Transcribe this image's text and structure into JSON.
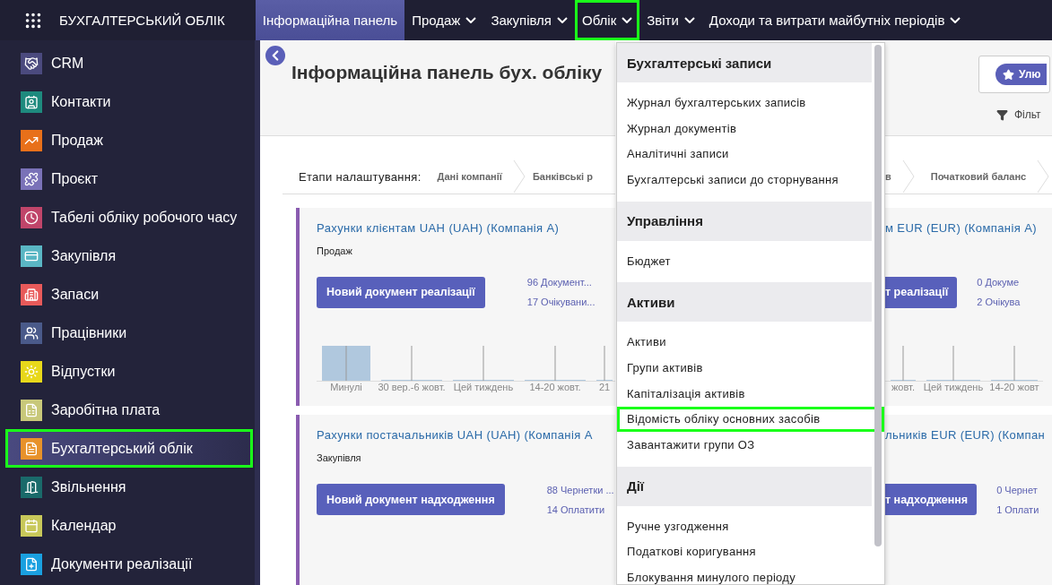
{
  "topbar": {
    "app_title": "БУХГАЛТЕРСЬКИЙ ОБЛІК",
    "menus": [
      {
        "label": "Інформаційна панель",
        "has_caret": false,
        "selected": true,
        "highlighted": false
      },
      {
        "label": "Продаж",
        "has_caret": true,
        "selected": false,
        "highlighted": false
      },
      {
        "label": "Закупівля",
        "has_caret": true,
        "selected": false,
        "highlighted": false
      },
      {
        "label": "Облік",
        "has_caret": true,
        "selected": false,
        "highlighted": true
      },
      {
        "label": "Звіти",
        "has_caret": true,
        "selected": false,
        "highlighted": false
      },
      {
        "label": "Доходи та витрати майбутніх періодів",
        "has_caret": true,
        "selected": false,
        "highlighted": false
      }
    ]
  },
  "sidebar": {
    "items": [
      {
        "label": "CRM",
        "color": "#4b4a7e",
        "selected": false,
        "highlighted": false
      },
      {
        "label": "Контакти",
        "color": "#1e8a7e",
        "selected": false,
        "highlighted": false
      },
      {
        "label": "Продаж",
        "color": "#e8701a",
        "selected": false,
        "highlighted": false
      },
      {
        "label": "Проєкт",
        "color": "#7a72b8",
        "selected": false,
        "highlighted": false
      },
      {
        "label": "Табелі обліку робочого часу",
        "color": "#c0456a",
        "selected": false,
        "highlighted": false
      },
      {
        "label": "Закупівля",
        "color": "#5ab6c4",
        "selected": false,
        "highlighted": false
      },
      {
        "label": "Запаси",
        "color": "#e85a5a",
        "selected": false,
        "highlighted": false
      },
      {
        "label": "Працівники",
        "color": "#4a5a8a",
        "selected": false,
        "highlighted": false
      },
      {
        "label": "Відпустки",
        "color": "#e8d81a",
        "selected": false,
        "highlighted": false
      },
      {
        "label": "Заробітна плата",
        "color": "#c8c87a",
        "selected": false,
        "highlighted": false
      },
      {
        "label": "Бухгалтерський облік",
        "color": "#e8922a",
        "selected": true,
        "highlighted": true
      },
      {
        "label": "Звільнення",
        "color": "#1a6a6a",
        "selected": false,
        "highlighted": false
      },
      {
        "label": "Календар",
        "color": "#c8c85a",
        "selected": false,
        "highlighted": false
      },
      {
        "label": "Документи реалізації",
        "color": "#1aa0e0",
        "selected": false,
        "highlighted": false
      }
    ]
  },
  "page": {
    "title": "Інформаційна панель бух. обліку",
    "favorites_button": "Улю",
    "filter_label": "Фільт",
    "setup": {
      "label": "Етапи налаштування:",
      "steps_left": [
        "Дані компанії",
        "Банківські р"
      ],
      "steps_right": [
        "в",
        "Початковий баланс"
      ]
    },
    "cards_left": [
      {
        "title": "Рахунки клієнтам UAH (UAH) (Компанія А)",
        "subtitle": "Продаж",
        "button": "Новий документ реалізації",
        "links": [
          "96 Документ...",
          "17 Очікувани..."
        ],
        "chart_labels": [
          "Минулі",
          "30 вер.-6 жовт.",
          "Цей тиждень",
          "14-20 жовт.",
          "21"
        ]
      },
      {
        "title": "Рахунки постачальників UAH (UAH) (Компанія А",
        "subtitle": "Закупівля",
        "button": "Новий документ надходження",
        "links": [
          "88 Чернетки ...",
          "14 Оплатити"
        ]
      }
    ],
    "cards_right": [
      {
        "title": "м EUR (EUR) (Компанія А)",
        "button": "т реалізації",
        "links": [
          "0 Докуме",
          "2 Очікува"
        ],
        "chart_labels": [
          "жовт.",
          "Цей тиждень",
          "14-20 жовт"
        ]
      },
      {
        "title": "льників EUR (EUR) (Компан",
        "button": "т надходження",
        "links": [
          "0 Чернет",
          "1 Оплати"
        ]
      }
    ]
  },
  "dropdown": {
    "sections": [
      {
        "title": "Бухгалтерські записи",
        "items": [
          {
            "label": "Журнал бухгалтерських записів",
            "highlighted": false
          },
          {
            "label": "Журнал документів",
            "highlighted": false
          },
          {
            "label": "Аналітичні записи",
            "highlighted": false
          },
          {
            "label": "Бухгалтерські записи до сторнування",
            "highlighted": false
          }
        ]
      },
      {
        "title": "Управління",
        "items": [
          {
            "label": "Бюджет",
            "highlighted": false
          }
        ]
      },
      {
        "title": "Активи",
        "items": [
          {
            "label": "Активи",
            "highlighted": false
          },
          {
            "label": "Групи активів",
            "highlighted": false
          },
          {
            "label": "Капіталізація активів",
            "highlighted": false
          },
          {
            "label": "Відомість обліку основних засобів",
            "highlighted": true
          },
          {
            "label": "Завантажити групи ОЗ",
            "highlighted": false
          }
        ]
      },
      {
        "title": "Дії",
        "items": [
          {
            "label": "Ручне узгодження",
            "highlighted": false
          },
          {
            "label": "Податкові коригування",
            "highlighted": false
          },
          {
            "label": "Блокування минулого періоду",
            "highlighted": false
          }
        ]
      }
    ]
  }
}
